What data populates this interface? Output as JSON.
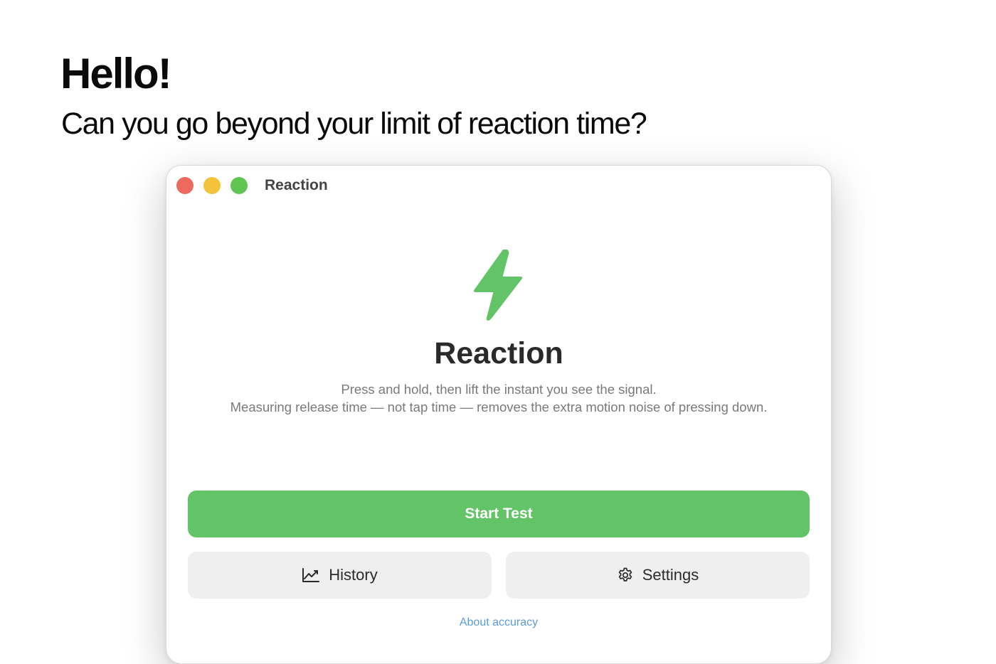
{
  "hero": {
    "title": "Hello!",
    "subtitle": "Can you go beyond your limit of reaction time?"
  },
  "window": {
    "title": "Reaction"
  },
  "main": {
    "icon": "lightning-bolt-icon",
    "app_name": "Reaction",
    "description_line1": "Press and hold, then lift the instant you see the signal.",
    "description_line2": "Measuring release time — not tap time — removes the extra motion noise of pressing down.",
    "start_button_label": "Start Test",
    "history_button_label": "History",
    "history_icon": "chart-line-icon",
    "settings_button_label": "Settings",
    "settings_icon": "gear-icon",
    "about_link_label": "About accuracy"
  },
  "colors": {
    "accent_green": "#63c467",
    "traffic_red": "#ed6a5e",
    "traffic_yellow": "#f5c33b",
    "traffic_green": "#61c554",
    "secondary_button_bg": "#efefef"
  }
}
